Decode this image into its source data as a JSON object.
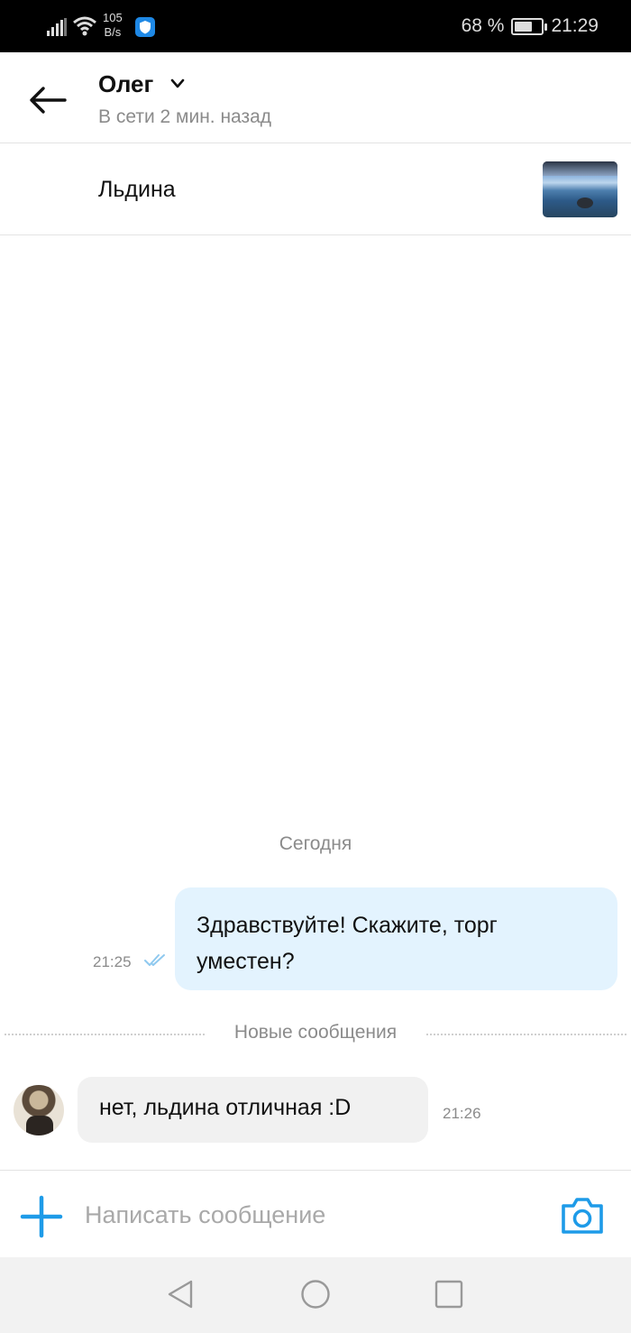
{
  "status_bar": {
    "net_speed_value": "105",
    "net_speed_unit": "B/s",
    "battery_text": "68 %",
    "battery_level": 0.68,
    "time": "21:29"
  },
  "header": {
    "contact_name": "Олег",
    "contact_status": "В сети 2 мин. назад"
  },
  "listing": {
    "title": "Льдина"
  },
  "chat": {
    "date_separator": "Сегодня",
    "outgoing": {
      "text": "Здравствуйте! Скажите, торг уместен?",
      "time": "21:25"
    },
    "new_messages_label": "Новые сообщения",
    "incoming": {
      "text": "нет, льдина отличная :D",
      "time": "21:26"
    }
  },
  "composer": {
    "placeholder": "Написать сообщение",
    "value": ""
  },
  "colors": {
    "accent": "#1e9be8",
    "outgoing_bubble": "#e3f3fe",
    "incoming_bubble": "#f1f1f1",
    "muted_text": "#8b8b8b"
  },
  "icons": {
    "back": "arrow-left-icon",
    "chevron": "chevron-down-icon",
    "read_receipt": "double-check-icon",
    "attach": "plus-icon",
    "camera": "camera-icon",
    "nav_back": "triangle-back-icon",
    "nav_home": "circle-home-icon",
    "nav_recent": "square-recent-icon"
  }
}
